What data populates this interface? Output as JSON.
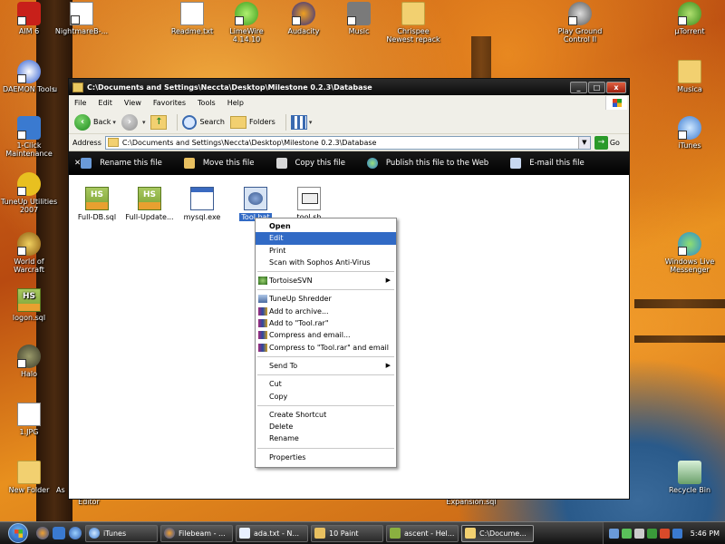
{
  "window": {
    "title": "C:\\Documents and Settings\\Neccta\\Desktop\\Milestone 0.2.3\\Database",
    "buttons": [
      "_",
      "□",
      "x"
    ]
  },
  "menu": [
    "File",
    "Edit",
    "View",
    "Favorites",
    "Tools",
    "Help"
  ],
  "toolbar": {
    "back": "Back",
    "search": "Search",
    "folders": "Folders"
  },
  "address": {
    "label": "Address",
    "value": "C:\\Documents and Settings\\Neccta\\Desktop\\Milestone 0.2.3\\Database",
    "go": "Go"
  },
  "tasks": [
    "Rename this file",
    "Move this file",
    "Copy this file",
    "Publish this file to the Web",
    "E-mail this file"
  ],
  "files": [
    {
      "name": "Full-DB.sql",
      "type": "hs"
    },
    {
      "name": "Full-Update...",
      "type": "hs"
    },
    {
      "name": "mysql.exe",
      "type": "exe"
    },
    {
      "name": "Tool.bat",
      "type": "bat",
      "selected": true
    },
    {
      "name": "tool.sh",
      "type": "sh"
    }
  ],
  "context_menu": [
    {
      "label": "Open",
      "bold": true
    },
    {
      "label": "Edit",
      "highlight": true
    },
    {
      "label": "Print"
    },
    {
      "label": "Scan with Sophos Anti-Virus"
    },
    {
      "sep": true
    },
    {
      "label": "TortoiseSVN",
      "submenu": true,
      "icon": "tortoise"
    },
    {
      "sep": true
    },
    {
      "label": "TuneUp Shredder",
      "icon": "shredder"
    },
    {
      "label": "Add to archive...",
      "icon": "rar"
    },
    {
      "label": "Add to \"Tool.rar\"",
      "icon": "rar"
    },
    {
      "label": "Compress and email...",
      "icon": "rar"
    },
    {
      "label": "Compress to \"Tool.rar\" and email",
      "icon": "rar"
    },
    {
      "sep": true
    },
    {
      "label": "Send To",
      "submenu": true
    },
    {
      "sep": true
    },
    {
      "label": "Cut"
    },
    {
      "label": "Copy"
    },
    {
      "sep": true
    },
    {
      "label": "Create Shortcut"
    },
    {
      "label": "Delete"
    },
    {
      "label": "Rename"
    },
    {
      "sep": true
    },
    {
      "label": "Properties"
    }
  ],
  "desktop_left": [
    "AIM 6",
    "DAEMON Tools",
    "1-Click Maintenance",
    "TuneUp Utilities 2007",
    "World of Warcraft",
    "logon.sql",
    "Halo",
    "1.JPG",
    "New Folder"
  ],
  "desktop_top": [
    "NightmareB-...",
    "Readme.txt",
    "LimeWire 4.14.10",
    "Audacity",
    "Music",
    "Chrispee Newest repack",
    "Play Ground Control II",
    "µTorrent"
  ],
  "desktop_right": [
    "Musica",
    "iTunes",
    "Windows Live Messenger",
    "Recycle Bin"
  ],
  "desktop_partial": [
    "u",
    "As",
    "Editor",
    "Expansion.sql"
  ],
  "taskbar": {
    "buttons": [
      "iTunes",
      "Filebeam - ...",
      "ada.txt - N...",
      "10 Paint",
      "ascent - Hel...",
      "C:\\Docume..."
    ],
    "clock": "5:46 PM"
  }
}
